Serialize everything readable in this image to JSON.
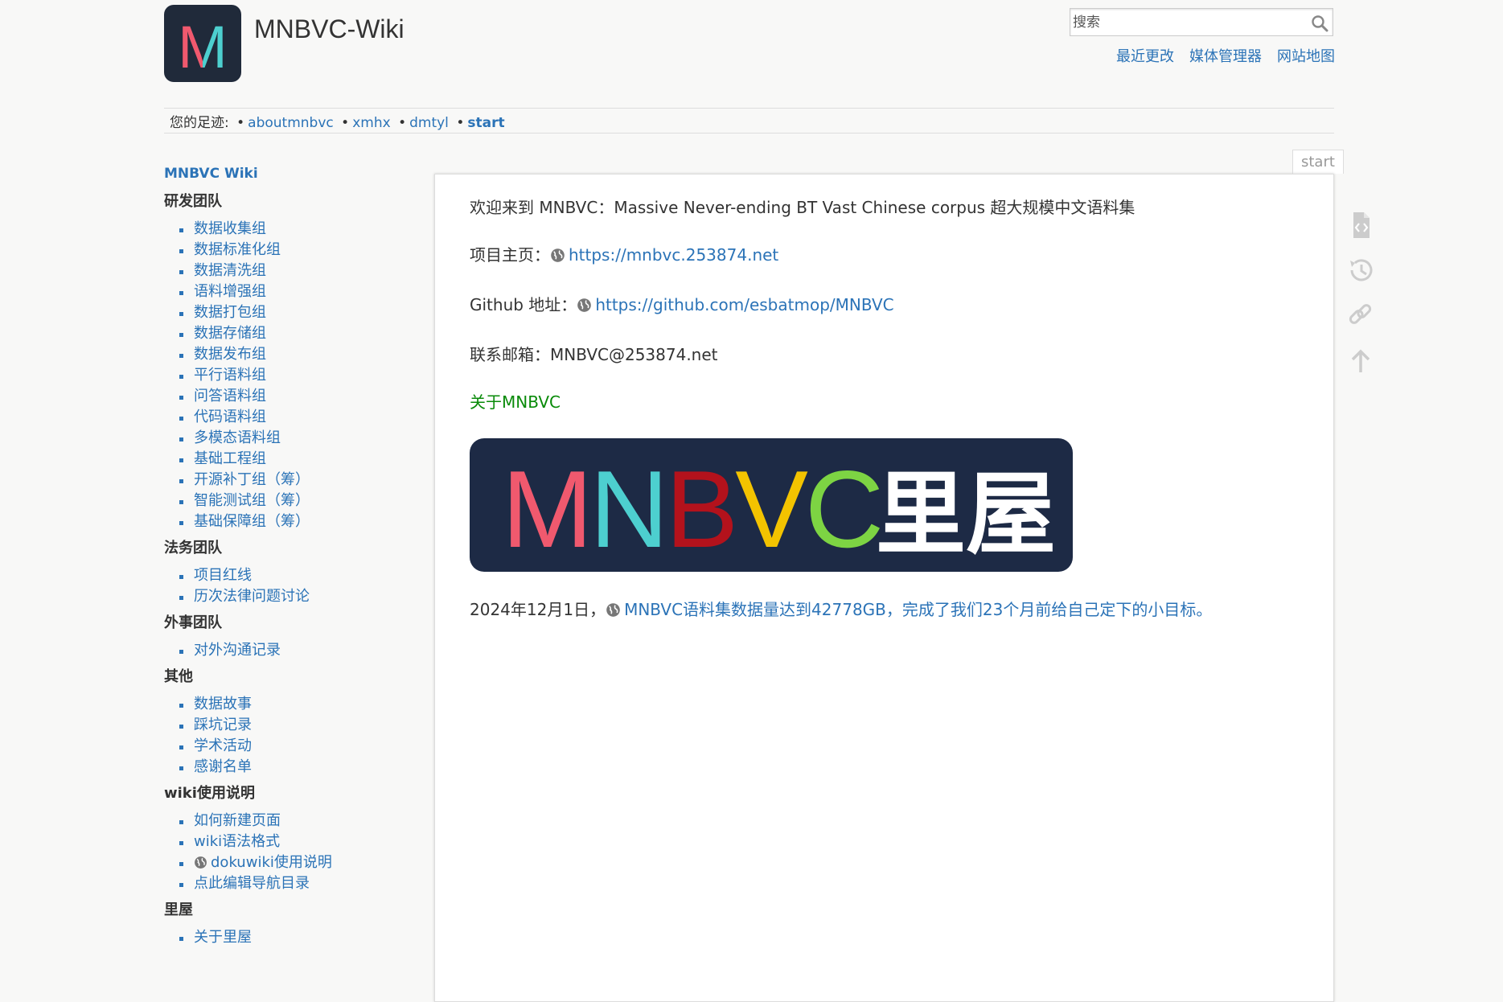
{
  "header": {
    "title": "MNBVC-Wiki",
    "logo_letter": "M",
    "search_placeholder": "搜索",
    "usertools": [
      "最近更改",
      "媒体管理器",
      "网站地图"
    ]
  },
  "breadcrumbs": {
    "prefix": "您的足迹:",
    "items": [
      "aboutmnbvc",
      "xmhx",
      "dmtyl"
    ],
    "current": "start"
  },
  "sidebar": {
    "wiki_title": "MNBVC Wiki",
    "sections": [
      {
        "heading": "研发团队",
        "items": [
          "数据收集组",
          "数据标准化组",
          "数据清洗组",
          "语料增强组",
          "数据打包组",
          "数据存储组",
          "数据发布组",
          "平行语料组",
          "问答语料组",
          "代码语料组",
          "多模态语料组",
          "基础工程组",
          "开源补丁组（筹）",
          "智能测试组（筹）",
          "基础保障组（筹）"
        ]
      },
      {
        "heading": "法务团队",
        "items": [
          "项目红线",
          "历次法律问题讨论"
        ]
      },
      {
        "heading": "外事团队",
        "items": [
          "对外沟通记录"
        ]
      },
      {
        "heading": "其他",
        "items": [
          "数据故事",
          "踩坑记录",
          "学术活动",
          "感谢名单"
        ]
      },
      {
        "heading": "wiki使用说明",
        "items": [
          "如何新建页面",
          "wiki语法格式",
          "dokuwiki使用说明",
          "点此编辑导航目录"
        ]
      },
      {
        "heading": "里屋",
        "items": [
          "关于里屋"
        ]
      }
    ]
  },
  "page": {
    "tab": "start",
    "welcome": "欢迎来到 MNBVC：Massive Never-ending BT Vast Chinese corpus 超大规模中文语料集",
    "homepage_label": "项目主页：",
    "homepage_url": "https://mnbvc.253874.net",
    "github_label": "Github 地址：",
    "github_url": "https://github.com/esbatmop/MNBVC",
    "email": "联系邮箱：MNBVC@253874.net",
    "about_link": "关于MNBVC",
    "banner": {
      "letters": [
        "M",
        "N",
        "B",
        "V",
        "C"
      ],
      "letter_colors": [
        "#f0596e",
        "#4dcfcf",
        "#b3121c",
        "#f3c300",
        "#7dd443"
      ],
      "suffix": "里屋"
    },
    "news_date": "2024年12月1日，",
    "news_link": "MNBVC语料集数据量达到42778GB，完成了我们23个月前给自己定下的小目标。"
  },
  "pagetools": [
    "view-source-icon",
    "old-revisions-icon",
    "backlinks-icon",
    "back-to-top-icon"
  ]
}
